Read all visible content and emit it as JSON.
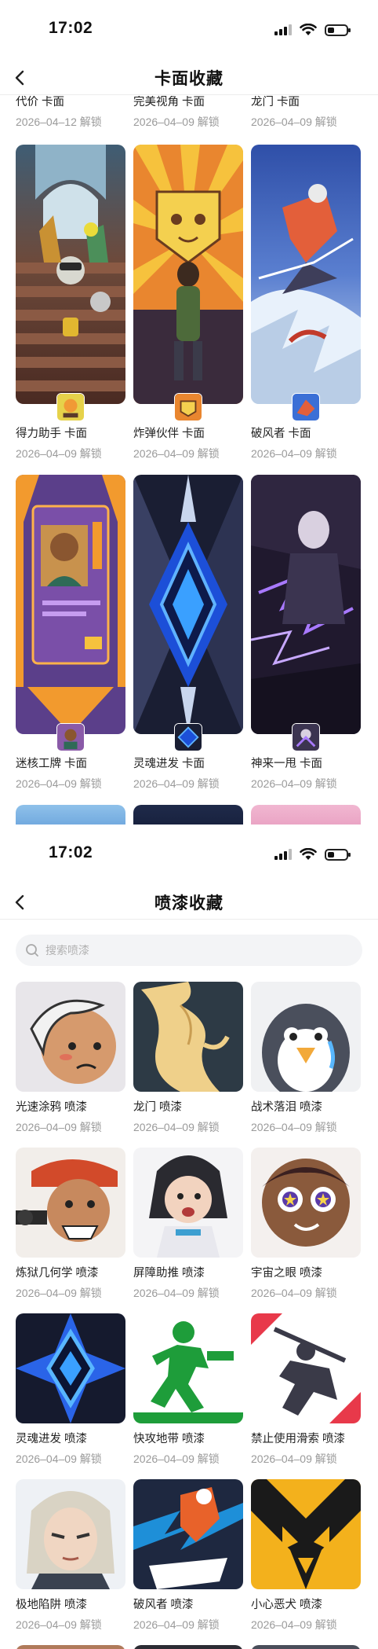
{
  "status": {
    "time": "17:02"
  },
  "screen1": {
    "title": "卡面收藏",
    "top_row": [
      {
        "name": "代价 卡面",
        "date": "2026–04–12 解锁"
      },
      {
        "name": "完美视角 卡面",
        "date": "2026–04–09 解锁"
      },
      {
        "name": "龙门 卡面",
        "date": "2026–04–09 解锁"
      }
    ],
    "cards": [
      {
        "name": "得力助手 卡面",
        "date": "2026–04–09 解锁",
        "art": "robot-stairs",
        "accent": "#e0722a"
      },
      {
        "name": "炸弹伙伴 卡面",
        "date": "2026–04–09 解锁",
        "art": "bomb-buddy",
        "accent": "#f2a23a"
      },
      {
        "name": "破风者 卡面",
        "date": "2026–04–09 解锁",
        "art": "wind-skier",
        "accent": "#3b6fd6"
      },
      {
        "name": "迷核工牌 卡面",
        "date": "2026–04–09 解锁",
        "art": "id-badge",
        "accent": "#f29a2e"
      },
      {
        "name": "灵魂进发 卡面",
        "date": "2026–04–09 解锁",
        "art": "blue-diamond",
        "accent": "#2b5fe0"
      },
      {
        "name": "神来一甩 卡面",
        "date": "2026–04–09 解锁",
        "art": "purple-storm",
        "accent": "#7b4bd6"
      }
    ]
  },
  "screen2": {
    "title": "喷漆收藏",
    "search_placeholder": "搜索喷漆",
    "sprays": [
      {
        "name": "光速涂鸦 喷漆",
        "date": "2026–04–09 解锁",
        "art": "grumpy-face"
      },
      {
        "name": "龙门 喷漆",
        "date": "2026–04–09 解锁",
        "art": "golden-dragon"
      },
      {
        "name": "战术落泪 喷漆",
        "date": "2026–04–09 解锁",
        "art": "crying-penguin"
      },
      {
        "name": "炼狱几何学 喷漆",
        "date": "2026–04–09 解锁",
        "art": "bandana-gunner"
      },
      {
        "name": "屏障助推 喷漆",
        "date": "2026–04–09 解锁",
        "art": "shouting-girl"
      },
      {
        "name": "宇宙之眼 喷漆",
        "date": "2026–04–09 解锁",
        "art": "star-eyes"
      },
      {
        "name": "灵魂进发 喷漆",
        "date": "2026–04–09 解锁",
        "art": "blue-diamond"
      },
      {
        "name": "快攻地带 喷漆",
        "date": "2026–04–09 解锁",
        "art": "green-runner"
      },
      {
        "name": "禁止使用滑索 喷漆",
        "date": "2026–04–09 解锁",
        "art": "zipline-sign"
      },
      {
        "name": "极地陷阱 喷漆",
        "date": "2026–04–09 解锁",
        "art": "polar-girl"
      },
      {
        "name": "破风者 喷漆",
        "date": "2026–04–09 解锁",
        "art": "wind-dash"
      },
      {
        "name": "小心恶犬 喷漆",
        "date": "2026–04–09 解锁",
        "art": "yellow-beast"
      }
    ]
  }
}
